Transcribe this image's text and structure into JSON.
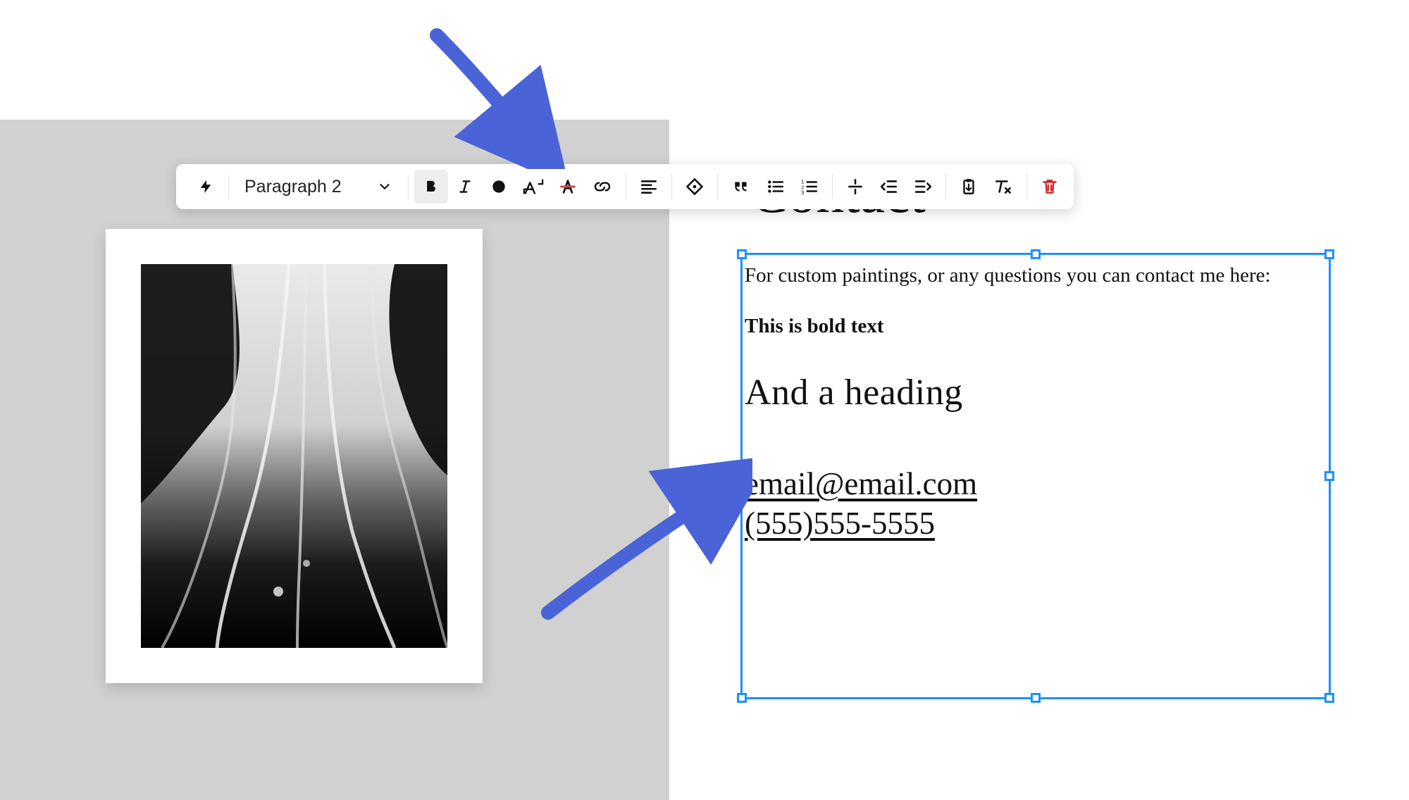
{
  "toolbar": {
    "style_label": "Paragraph 2"
  },
  "page": {
    "hidden_heading": "Contact"
  },
  "textBlock": {
    "paragraph": "For custom paintings, or any questions you can contact me here:",
    "bold_text": "This is bold text",
    "heading": "And a heading",
    "email": "email@email.com",
    "phone": "(555)555-5555"
  }
}
